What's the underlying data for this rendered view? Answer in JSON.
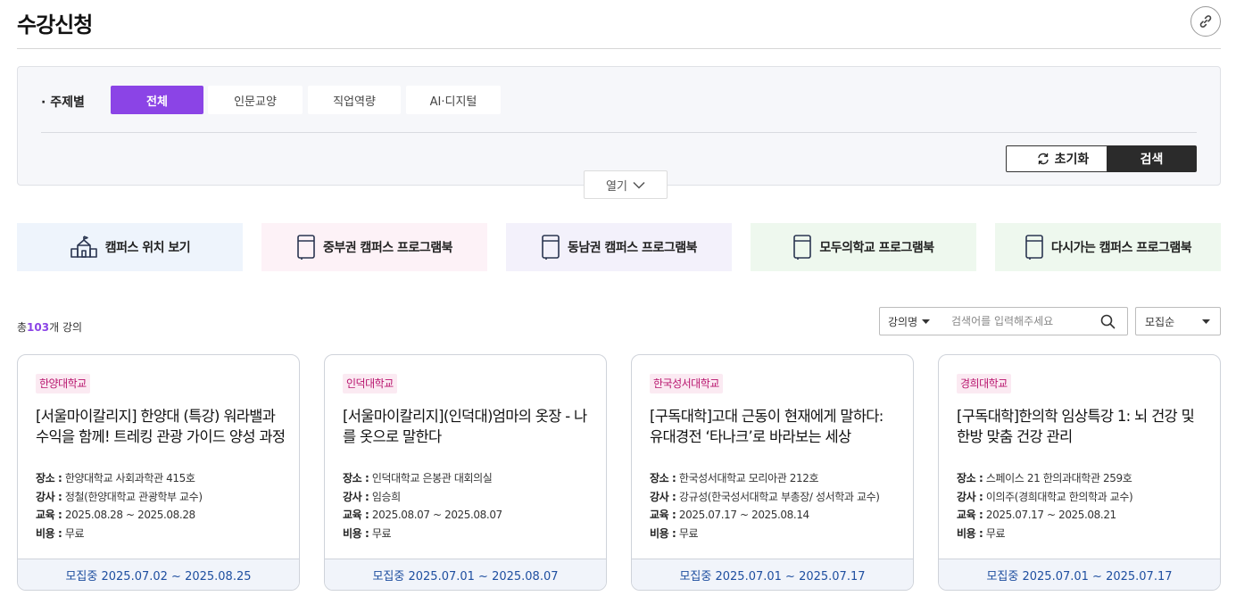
{
  "header": {
    "title": "수강신청"
  },
  "filter": {
    "label": "· 주제별",
    "chips": [
      {
        "label": "전체",
        "active": true
      },
      {
        "label": "인문교양",
        "active": false
      },
      {
        "label": "직업역량",
        "active": false
      },
      {
        "label": "AI·디지털",
        "active": false
      }
    ],
    "reset_label": "초기화",
    "search_label": "검색",
    "expand_label": "열기"
  },
  "quick_links": [
    {
      "label": "캠퍼스 위치 보기",
      "icon": "campus-building-icon",
      "bg": "#eef4fc"
    },
    {
      "label": "중부권 캠퍼스 프로그램북",
      "icon": "book-icon",
      "bg": "#fdf2f7"
    },
    {
      "label": "동남권 캠퍼스 프로그램북",
      "icon": "book-icon",
      "bg": "#f3f1fb"
    },
    {
      "label": "모두의학교 프로그램북",
      "icon": "book-icon",
      "bg": "#eef8ee"
    },
    {
      "label": "다시가는 캠퍼스 프로그램북",
      "icon": "book-icon",
      "bg": "#eef8ee"
    }
  ],
  "list": {
    "total_prefix": "총",
    "total_count": "103",
    "total_suffix": "개 강의",
    "search_type": "강의명",
    "search_placeholder": "검색어를 입력해주세요",
    "sort_label": "모집순"
  },
  "info_labels": {
    "place": "장소 :",
    "teacher": "강사 :",
    "edu": "교육 :",
    "cost": "비용 :"
  },
  "colors": {
    "accent": "#8b44e6",
    "badge_bg": "#fbeaf2",
    "badge_text": "#b8156e",
    "footer_text": "#1f4fa0"
  },
  "courses": [
    {
      "school": "한양대학교",
      "title": "[서울마이칼리지] 한양대 (특강) 워라밸과 수익을 함께! 트레킹 관광 가이드 양성 과정",
      "place": "한양대학교 사회과학관 415호",
      "teacher": "정철(한양대학교 관광학부 교수)",
      "edu": "2025.08.28 ~ 2025.08.28",
      "cost": "무료",
      "recruit": "모집중 2025.07.02 ~ 2025.08.25"
    },
    {
      "school": "인덕대학교",
      "title": "[서울마이칼리지](인덕대)엄마의 옷장 - 나를 옷으로 말한다",
      "place": "인덕대학교 은봉관 대회의실",
      "teacher": "임승희",
      "edu": "2025.08.07 ~ 2025.08.07",
      "cost": "무료",
      "recruit": "모집중 2025.07.01 ~ 2025.08.07"
    },
    {
      "school": "한국성서대학교",
      "title": "[구독대학]고대 근동이 현재에게 말하다: 유대경전 ‘타나크’로 바라보는 세상",
      "place": "한국성서대학교 모리아관 212호",
      "teacher": "강규성(한국성서대학교 부총장/ 성서학과 교수)",
      "edu": "2025.07.17 ~ 2025.08.14",
      "cost": "무료",
      "recruit": "모집중 2025.07.01 ~ 2025.07.17"
    },
    {
      "school": "경희대학교",
      "title": "[구독대학]한의학 임상특강 1: 뇌 건강 및 한방 맞춤 건강 관리",
      "place": "스페이스 21 한의과대학관 259호",
      "teacher": " 이의주(경희대학교 한의학과 교수)",
      "edu": "2025.07.17 ~ 2025.08.21",
      "cost": "무료",
      "recruit": "모집중 2025.07.01 ~ 2025.07.17"
    }
  ]
}
